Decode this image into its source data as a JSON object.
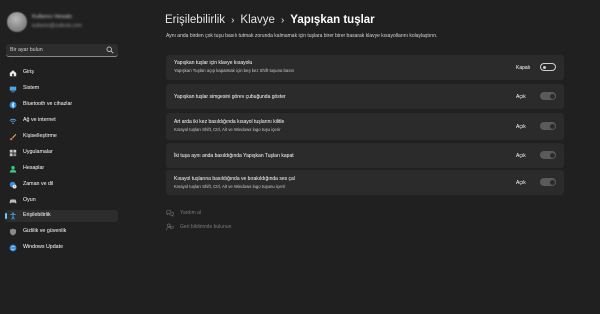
{
  "profile": {
    "name": "Kullanıcı Hesabı",
    "email": "kullanici@outlook.com"
  },
  "search": {
    "placeholder": "Bir ayar bulun"
  },
  "sidebar": {
    "items": [
      {
        "label": "Giriş",
        "icon": "home-icon",
        "active": false
      },
      {
        "label": "Sistem",
        "icon": "system-icon",
        "active": false
      },
      {
        "label": "Bluetooth ve cihazlar",
        "icon": "bluetooth-icon",
        "active": false
      },
      {
        "label": "Ağ ve internet",
        "icon": "wifi-icon",
        "active": false
      },
      {
        "label": "Kişiselleştirme",
        "icon": "brush-icon",
        "active": false
      },
      {
        "label": "Uygulamalar",
        "icon": "apps-icon",
        "active": false
      },
      {
        "label": "Hesaplar",
        "icon": "person-icon",
        "active": false
      },
      {
        "label": "Zaman ve dil",
        "icon": "globe-clock-icon",
        "active": false
      },
      {
        "label": "Oyun",
        "icon": "gamepad-icon",
        "active": false
      },
      {
        "label": "Erişilebilirlik",
        "icon": "accessibility-icon",
        "active": true
      },
      {
        "label": "Gizlilik ve güvenlik",
        "icon": "shield-icon",
        "active": false
      },
      {
        "label": "Windows Update",
        "icon": "update-icon",
        "active": false
      }
    ]
  },
  "breadcrumb": {
    "level1": "Erişilebilirlik",
    "level2": "Klavye",
    "current": "Yapışkan tuşlar",
    "separator": "›"
  },
  "description": "Aynı anda birden çok tuşu basılı tutmak zorunda kalmamak için tuşlara birer birer basarak klavye kısayollarını kolaylaştırın.",
  "settings": [
    {
      "title": "Yapışkan tuşlar için klavye kısayolu",
      "subtitle": "Yapışkan Tuşları açıp kapatmak için beş kez Shift tuşuna basın",
      "state_label": "Kapalı",
      "on": false
    },
    {
      "title": "Yapışkan tuşlar simgesini görev çubuğunda göster",
      "subtitle": "",
      "state_label": "Açık",
      "on": true
    },
    {
      "title": "Art arda iki kez basıldığında kısayol tuşlarını kilitle",
      "subtitle": "Kısayol tuşları Shift, Ctrl, Alt ve Windows logo tuşu içerir",
      "state_label": "Açık",
      "on": true
    },
    {
      "title": "İki tuşa aynı anda basıldığında Yapışkan Tuşları kapat",
      "subtitle": "",
      "state_label": "Açık",
      "on": true
    },
    {
      "title": "Kısayol tuşlarına basıldığında ve bırakıldığında ses çal",
      "subtitle": "Kısayol tuşları Shift, Ctrl, Alt ve Windows logo tuşunu içerir",
      "state_label": "Açık",
      "on": true
    }
  ],
  "links": {
    "help": "Yardım al",
    "feedback": "Geri bildirimde bulunun"
  },
  "colors": {
    "accent": "#60cdff",
    "background": "#202020",
    "card": "#2b2b2b"
  }
}
